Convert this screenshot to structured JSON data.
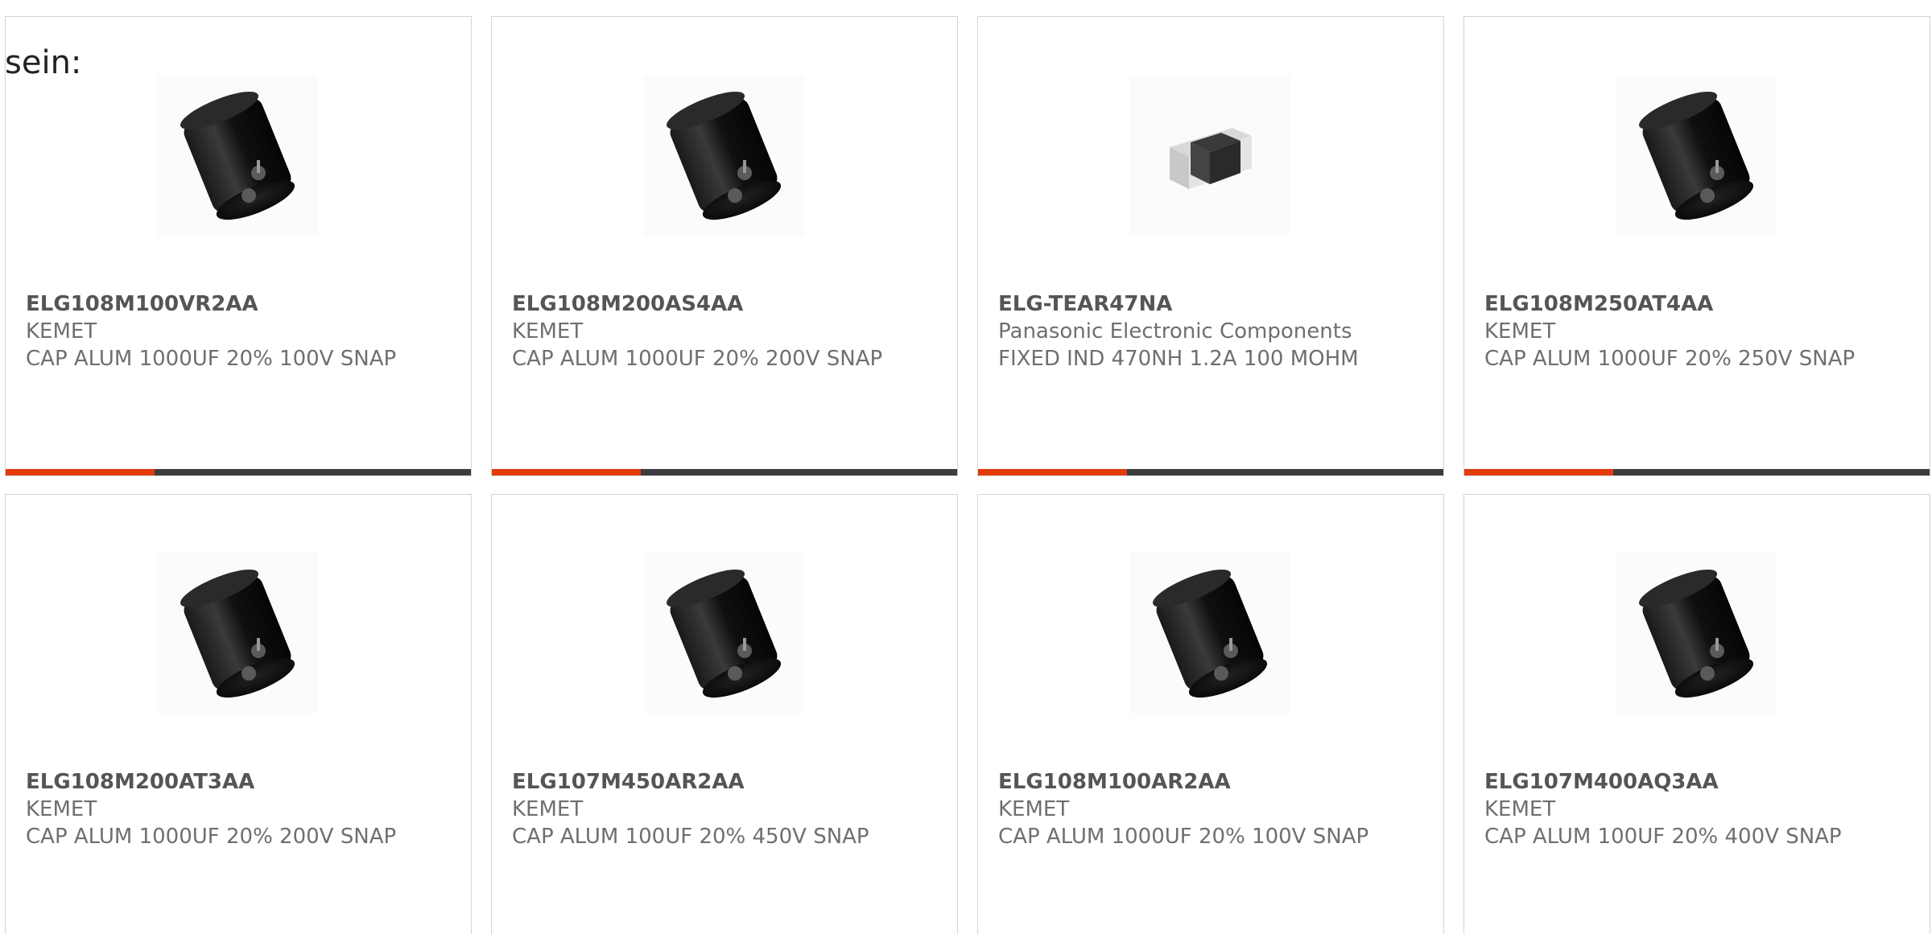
{
  "intro": {
    "text": "sein:"
  },
  "colors": {
    "accent": "#e33b0c",
    "track": "#3d3d3d",
    "border": "#d4d4d4",
    "text": "#6f6f6f"
  },
  "products": [
    {
      "part_number": "ELG108M100VR2AA",
      "manufacturer": "KEMET",
      "description": "CAP ALUM 1000UF 20% 100V SNAP",
      "image": "capacitor-image",
      "progress": 0.32,
      "show_progress": true
    },
    {
      "part_number": "ELG108M200AS4AA",
      "manufacturer": "KEMET",
      "description": "CAP ALUM 1000UF 20% 200V SNAP",
      "image": "capacitor-image",
      "progress": 0.32,
      "show_progress": true
    },
    {
      "part_number": "ELG-TEAR47NA",
      "manufacturer": "Panasonic Electronic Components",
      "description": "FIXED IND 470NH 1.2A 100 MOHM",
      "image": "inductor-chip-image",
      "progress": 0.32,
      "show_progress": true
    },
    {
      "part_number": "ELG108M250AT4AA",
      "manufacturer": "KEMET",
      "description": "CAP ALUM 1000UF 20% 250V SNAP",
      "image": "capacitor-image",
      "progress": 0.32,
      "show_progress": true
    },
    {
      "part_number": "ELG108M200AT3AA",
      "manufacturer": "KEMET",
      "description": "CAP ALUM 1000UF 20% 200V SNAP",
      "image": "capacitor-image",
      "progress": 0,
      "show_progress": false
    },
    {
      "part_number": "ELG107M450AR2AA",
      "manufacturer": "KEMET",
      "description": "CAP ALUM 100UF 20% 450V SNAP",
      "image": "capacitor-image",
      "progress": 0,
      "show_progress": false
    },
    {
      "part_number": "ELG108M100AR2AA",
      "manufacturer": "KEMET",
      "description": "CAP ALUM 1000UF 20% 100V SNAP",
      "image": "capacitor-image",
      "progress": 0,
      "show_progress": false
    },
    {
      "part_number": "ELG107M400AQ3AA",
      "manufacturer": "KEMET",
      "description": "CAP ALUM 100UF 20% 400V SNAP",
      "image": "capacitor-image",
      "progress": 0,
      "show_progress": false
    }
  ]
}
